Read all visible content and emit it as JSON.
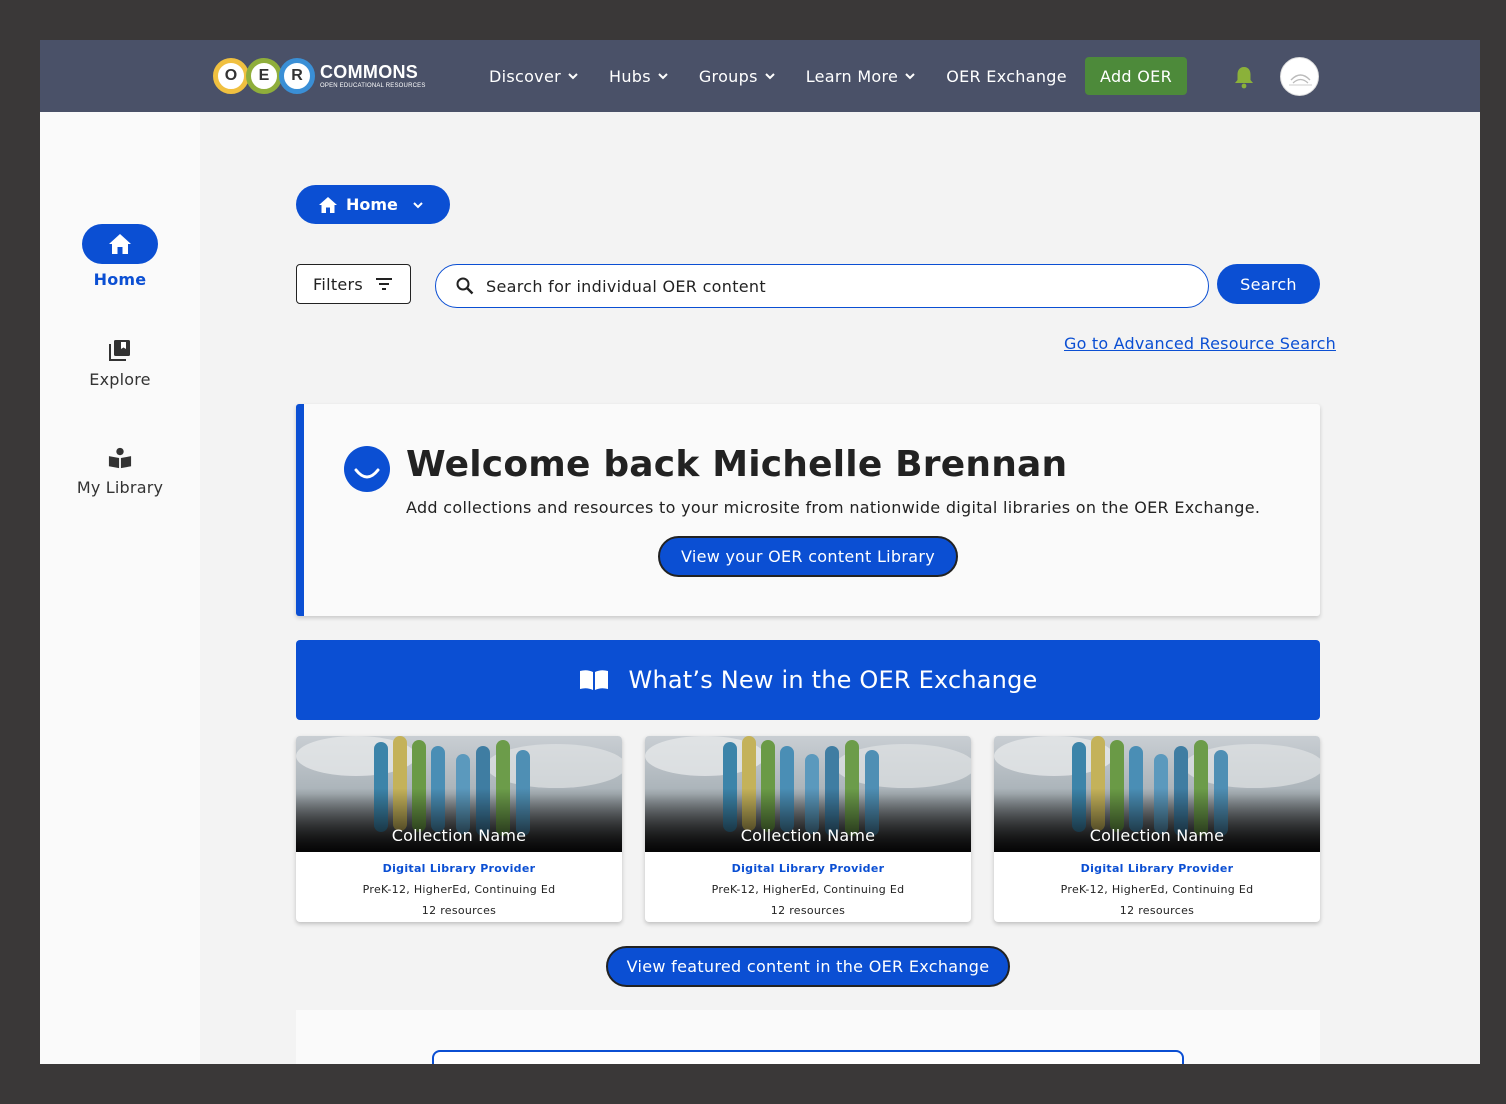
{
  "brand": {
    "letters": [
      "O",
      "E",
      "R"
    ],
    "wordmark": "COMMONS",
    "tagline": "OPEN EDUCATIONAL RESOURCES",
    "ring_colors": [
      "#f0c040",
      "#8fae3b",
      "#3a8fd6"
    ]
  },
  "nav": {
    "items": [
      {
        "label": "Discover",
        "has_dropdown": true
      },
      {
        "label": "Hubs",
        "has_dropdown": true
      },
      {
        "label": "Groups",
        "has_dropdown": true
      },
      {
        "label": "Learn More",
        "has_dropdown": true
      },
      {
        "label": "OER Exchange",
        "has_dropdown": false
      }
    ],
    "add_button": "Add OER",
    "bell_icon": "bell-icon",
    "avatar_icon": "avatar"
  },
  "sidebar": {
    "items": [
      {
        "label": "Home",
        "icon": "home-icon",
        "active": true
      },
      {
        "label": "Explore",
        "icon": "collection-icon",
        "active": false
      },
      {
        "label": "My Library",
        "icon": "reader-icon",
        "active": false
      }
    ]
  },
  "breadcrumb": {
    "label": "Home"
  },
  "search": {
    "filters_label": "Filters",
    "placeholder": "Search for individual OER content",
    "button": "Search",
    "advanced_link": "Go to Advanced Resource Search"
  },
  "welcome": {
    "title": "Welcome back Michelle Brennan",
    "subtitle": "Add collections and resources to your microsite from nationwide digital libraries on the OER Exchange.",
    "button": "View your OER content Library"
  },
  "whats_new": {
    "title": "What’s New in the OER Exchange",
    "icon": "open-book-icon"
  },
  "cards": [
    {
      "name": "Collection Name",
      "provider": "Digital Library Provider",
      "levels": "PreK-12, HigherEd, Continuing Ed",
      "count": "12 resources"
    },
    {
      "name": "Collection Name",
      "provider": "Digital Library Provider",
      "levels": "PreK-12, HigherEd, Continuing Ed",
      "count": "12 resources"
    },
    {
      "name": "Collection Name",
      "provider": "Digital Library Provider",
      "levels": "PreK-12, HigherEd, Continuing Ed",
      "count": "12 resources"
    }
  ],
  "featured_button": "View featured content in the OER Exchange",
  "colors": {
    "primary": "#0b4fd3",
    "nav_bg": "#4a5168",
    "add_button": "#4d8a3a",
    "bell": "#8bb13a"
  }
}
